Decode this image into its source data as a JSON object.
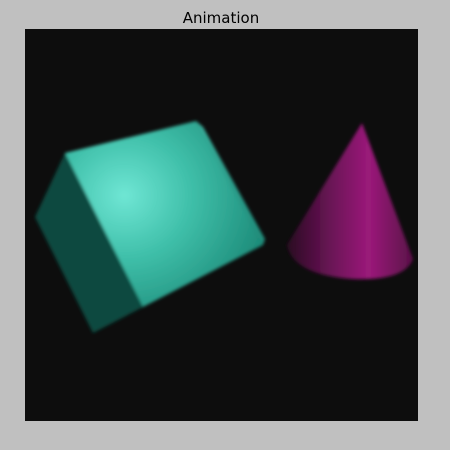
{
  "window": {
    "title": "Animation"
  },
  "scene": {
    "background_color": "#0d0d0d",
    "objects": [
      {
        "name": "cube",
        "color": "#1e9a86"
      },
      {
        "name": "cone",
        "color": "#9b1a7a"
      }
    ]
  }
}
